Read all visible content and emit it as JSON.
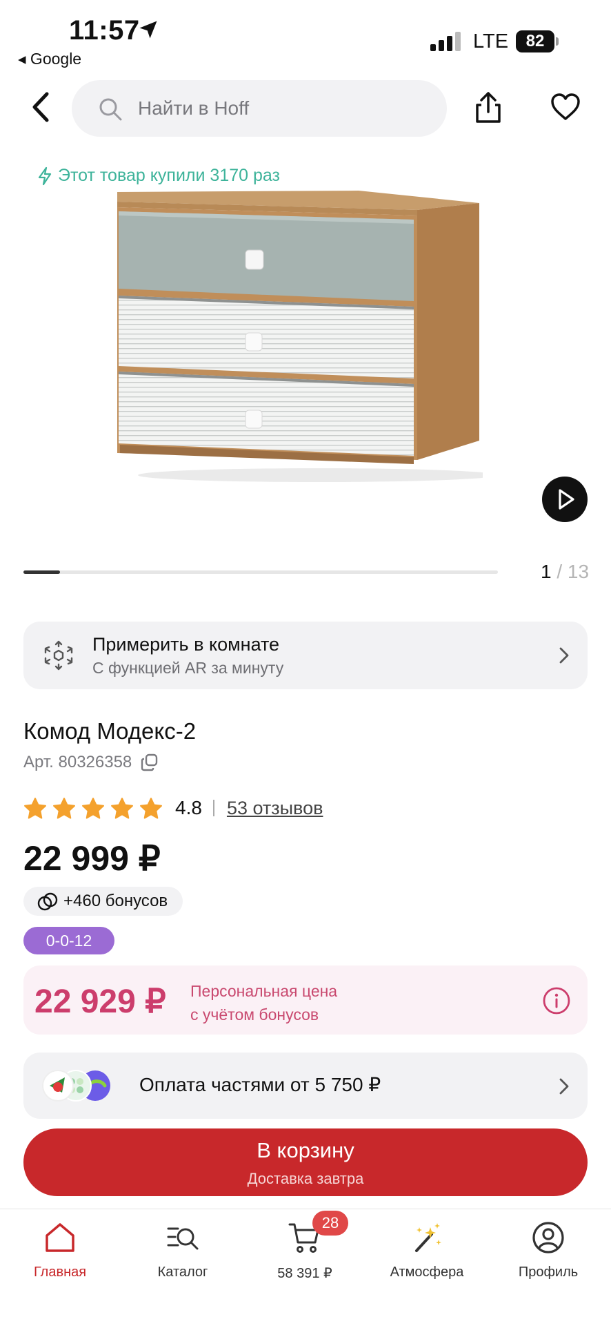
{
  "status_bar": {
    "time": "11:57",
    "back_app": "◂ Google",
    "network": "LTE",
    "battery": "82"
  },
  "search": {
    "placeholder": "Найти в Hoff"
  },
  "gallery": {
    "bought_text": "Этот товар купили 3170 раз",
    "current": "1",
    "total": "/ 13",
    "progress": 0.0769
  },
  "ar": {
    "title": "Примерить в комнате",
    "subtitle": "С функцией AR за минуту"
  },
  "product": {
    "title": "Комод Модекс-2",
    "article": "Арт. 80326358",
    "rating": "4.8",
    "stars": 5,
    "reviews": "53 отзывов",
    "price": "22 999 ₽",
    "bonus": "+460 бонусов",
    "installment_tag": "0-0-12"
  },
  "personal": {
    "price": "22 929 ₽",
    "text_line1": "Персональная цена",
    "text_line2": "с учётом бонусов"
  },
  "split": {
    "text": "Оплата частями от 5 750 ₽"
  },
  "cart_button": {
    "label": "В корзину",
    "sub": "Доставка завтра"
  },
  "tabs": [
    {
      "label": "Главная",
      "icon": "home-icon",
      "active": true
    },
    {
      "label": "Каталог",
      "icon": "catalog-search-icon"
    },
    {
      "label": "58 391 ₽",
      "icon": "cart-icon",
      "badge": "28"
    },
    {
      "label": "Атмосфера",
      "icon": "magic-wand-icon"
    },
    {
      "label": "Профиль",
      "icon": "profile-icon"
    }
  ],
  "colors": {
    "accent": "#c8282b",
    "bought": "#3db39a",
    "personal": "#cc3d6c",
    "installment": "#9b6bd4",
    "star": "#f4a12d"
  }
}
